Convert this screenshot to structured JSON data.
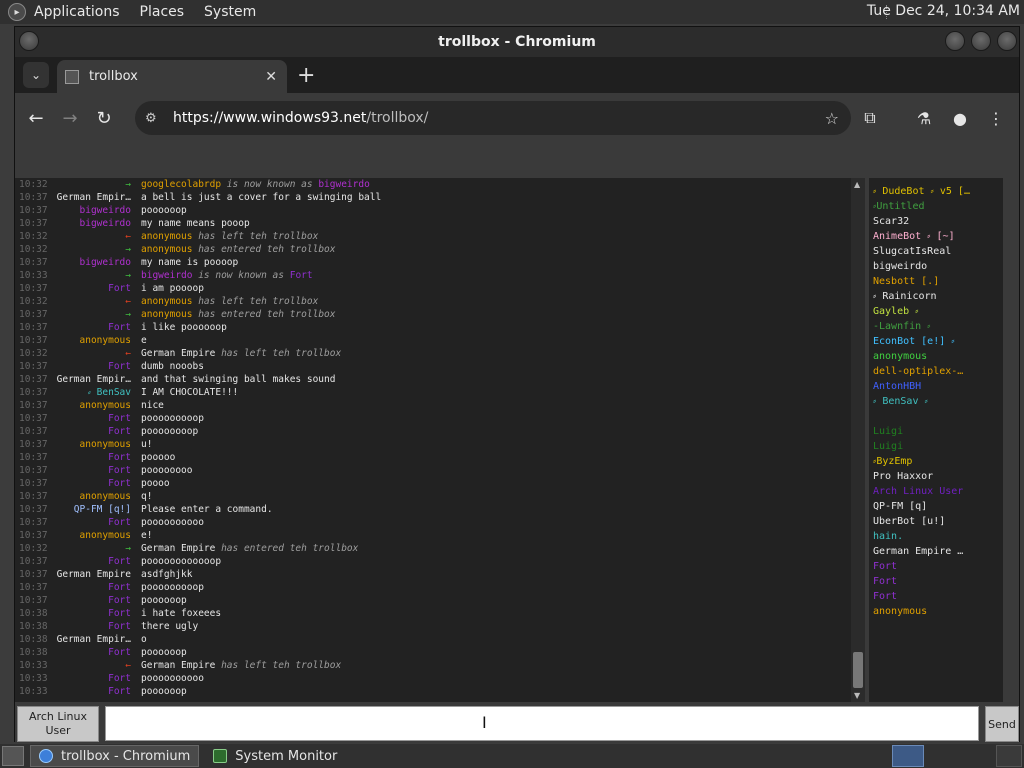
{
  "top_panel": {
    "menus": [
      "Applications",
      "Places",
      "System"
    ],
    "clock": "Tue Dec 24, 10:34 AM"
  },
  "window": {
    "title": "trollbox - Chromium"
  },
  "browser": {
    "tab_title": "trollbox",
    "url_host": "https://www.windows93.net",
    "url_path": "/trollbox/"
  },
  "chat": {
    "messages": [
      {
        "time": "10:32",
        "nick": "→",
        "nick_color": "#40c040",
        "text": "",
        "sys": true,
        "who": "googlecolabrdp",
        "who_color": "#e0a000",
        "action": "is now known as",
        "target": "bigweirdo",
        "target_color": "#b030d0"
      },
      {
        "time": "10:37",
        "nick": "German Empir…",
        "nick_color": "#e6e6e6",
        "text": "a bell is just a cover for a swinging ball"
      },
      {
        "time": "10:37",
        "nick": "bigweirdo",
        "nick_color": "#b030d0",
        "text": "poooooop"
      },
      {
        "time": "10:37",
        "nick": "bigweirdo",
        "nick_color": "#b030d0",
        "text": "my name means pooop"
      },
      {
        "time": "10:32",
        "nick": "←",
        "nick_color": "#e04020",
        "sys": true,
        "who": "anonymous",
        "who_color": "#e0a000",
        "action": "has left teh trollbox"
      },
      {
        "time": "10:32",
        "nick": "→",
        "nick_color": "#40c040",
        "sys": true,
        "who": "anonymous",
        "who_color": "#e0a000",
        "action": "has entered teh trollbox"
      },
      {
        "time": "10:37",
        "nick": "bigweirdo",
        "nick_color": "#b030d0",
        "text": "my name is poooop"
      },
      {
        "time": "10:33",
        "nick": "→",
        "nick_color": "#40c040",
        "sys": true,
        "who": "bigweirdo",
        "who_color": "#b030d0",
        "action": "is now known as",
        "target": "Fort",
        "target_color": "#9030d0"
      },
      {
        "time": "10:37",
        "nick": "Fort",
        "nick_color": "#9030d0",
        "text": "i am poooop"
      },
      {
        "time": "10:32",
        "nick": "←",
        "nick_color": "#e04020",
        "sys": true,
        "who": "anonymous",
        "who_color": "#e0a000",
        "action": "has left teh trollbox"
      },
      {
        "time": "10:37",
        "nick": "→",
        "nick_color": "#40c040",
        "sys": true,
        "who": "anonymous",
        "who_color": "#e0a000",
        "action": "has entered teh trollbox"
      },
      {
        "time": "10:37",
        "nick": "Fort",
        "nick_color": "#9030d0",
        "text": "i like poooooop"
      },
      {
        "time": "10:37",
        "nick": "anonymous",
        "nick_color": "#e0a000",
        "text": "e"
      },
      {
        "time": "10:32",
        "nick": "←",
        "nick_color": "#e04020",
        "sys": true,
        "who": "German Empire",
        "who_color": "#e6e6e6",
        "action": "has left teh trollbox"
      },
      {
        "time": "10:37",
        "nick": "Fort",
        "nick_color": "#9030d0",
        "text": "dumb nooobs"
      },
      {
        "time": "10:37",
        "nick": "German Empir…",
        "nick_color": "#e6e6e6",
        "text": "and that swinging ball makes sound"
      },
      {
        "time": "10:37",
        "nick": "⸗ BenSav",
        "nick_color": "#40c0c0",
        "text": "I AM CHOCOLATE!!!"
      },
      {
        "time": "10:37",
        "nick": "anonymous",
        "nick_color": "#e0a000",
        "text": "nice"
      },
      {
        "time": "10:37",
        "nick": "Fort",
        "nick_color": "#9030d0",
        "text": "pooooooooop"
      },
      {
        "time": "10:37",
        "nick": "Fort",
        "nick_color": "#9030d0",
        "text": "poooooooop"
      },
      {
        "time": "10:37",
        "nick": "anonymous",
        "nick_color": "#e0a000",
        "text": "u!"
      },
      {
        "time": "10:37",
        "nick": "Fort",
        "nick_color": "#9030d0",
        "text": "pooooo"
      },
      {
        "time": "10:37",
        "nick": "Fort",
        "nick_color": "#9030d0",
        "text": "poooooooo"
      },
      {
        "time": "10:37",
        "nick": "Fort",
        "nick_color": "#9030d0",
        "text": "poooo"
      },
      {
        "time": "10:37",
        "nick": "anonymous",
        "nick_color": "#e0a000",
        "text": "q!"
      },
      {
        "time": "10:37",
        "nick": "QP-FM [q!]",
        "nick_color": "#a0c0ff",
        "text": "Please enter a command."
      },
      {
        "time": "10:37",
        "nick": "Fort",
        "nick_color": "#9030d0",
        "text": "poooooooooo"
      },
      {
        "time": "10:37",
        "nick": "anonymous",
        "nick_color": "#e0a000",
        "text": "e!"
      },
      {
        "time": "10:32",
        "nick": "→",
        "nick_color": "#40c040",
        "sys": true,
        "who": "German Empire",
        "who_color": "#e6e6e6",
        "action": "has entered teh trollbox"
      },
      {
        "time": "10:37",
        "nick": "Fort",
        "nick_color": "#9030d0",
        "text": "poooooooooooop"
      },
      {
        "time": "10:37",
        "nick": "German Empire",
        "nick_color": "#e6e6e6",
        "text": "asdfghjkk"
      },
      {
        "time": "10:37",
        "nick": "Fort",
        "nick_color": "#9030d0",
        "text": "pooooooooop"
      },
      {
        "time": "10:37",
        "nick": "Fort",
        "nick_color": "#9030d0",
        "text": "poooooop"
      },
      {
        "time": "10:38",
        "nick": "Fort",
        "nick_color": "#9030d0",
        "text": "i hate foxeees"
      },
      {
        "time": "10:38",
        "nick": "Fort",
        "nick_color": "#9030d0",
        "text": "there ugly"
      },
      {
        "time": "10:38",
        "nick": "German Empir…",
        "nick_color": "#e6e6e6",
        "text": "o"
      },
      {
        "time": "10:38",
        "nick": "Fort",
        "nick_color": "#9030d0",
        "text": "poooooop"
      },
      {
        "time": "10:33",
        "nick": "←",
        "nick_color": "#e04020",
        "sys": true,
        "who": "German Empire",
        "who_color": "#e6e6e6",
        "action": "has left teh trollbox"
      },
      {
        "time": "10:33",
        "nick": "Fort",
        "nick_color": "#9030d0",
        "text": "poooooooooo"
      },
      {
        "time": "10:33",
        "nick": "Fort",
        "nick_color": "#9030d0",
        "text": "poooooop"
      }
    ]
  },
  "users": [
    {
      "name": "⸗ DudeBot ⸗ v5 […",
      "color": "#e0c000"
    },
    {
      "name": "⸗Untitled",
      "color": "#40a040"
    },
    {
      "name": "Scar32",
      "color": "#e6e6e6"
    },
    {
      "name": "AnimeBot ⸗ [~]",
      "color": "#ffb0d0"
    },
    {
      "name": "SlugcatIsReal",
      "color": "#e6e6e6"
    },
    {
      "name": "bigweirdo",
      "color": "#e6e6e6"
    },
    {
      "name": "Nesbott [.]",
      "color": "#e0a000"
    },
    {
      "name": "⸗ Rainicorn",
      "color": "#e6e6e6"
    },
    {
      "name": "Gayleb ⸗",
      "color": "#c0e040"
    },
    {
      "name": "-Lawnfin ⸗",
      "color": "#40a040"
    },
    {
      "name": "EconBot [e!] ⸗",
      "color": "#40c0ff"
    },
    {
      "name": "anonymous",
      "color": "#40d040"
    },
    {
      "name": "dell-optiplex-…",
      "color": "#e0a000"
    },
    {
      "name": "AntonHBH",
      "color": "#4060ff"
    },
    {
      "name": "⸗ BenSav ⸗",
      "color": "#40c0c0"
    },
    {
      "name": "",
      "color": "#3a2a6a"
    },
    {
      "name": "Luigi",
      "color": "#208020"
    },
    {
      "name": "Luigi",
      "color": "#208020"
    },
    {
      "name": "⸗ByzEmp",
      "color": "#e0c000"
    },
    {
      "name": "Pro Haxxor",
      "color": "#e6e6e6"
    },
    {
      "name": "Arch Linux User",
      "color": "#7020c0"
    },
    {
      "name": "QP-FM [q]",
      "color": "#e6e6e6"
    },
    {
      "name": "UberBot [u!]",
      "color": "#e6e6e6"
    },
    {
      "name": "hain.",
      "color": "#40c0c0"
    },
    {
      "name": "German Empire …",
      "color": "#e6e6e6"
    },
    {
      "name": "Fort",
      "color": "#9030d0"
    },
    {
      "name": "Fort",
      "color": "#9030d0"
    },
    {
      "name": "Fort",
      "color": "#9030d0"
    },
    {
      "name": "anonymous",
      "color": "#e0a000"
    }
  ],
  "input": {
    "nick_line1": "Arch Linux",
    "nick_line2": "User",
    "send_label": "Send"
  },
  "taskbar": {
    "tasks": [
      "trollbox - Chromium",
      "System Monitor"
    ]
  }
}
